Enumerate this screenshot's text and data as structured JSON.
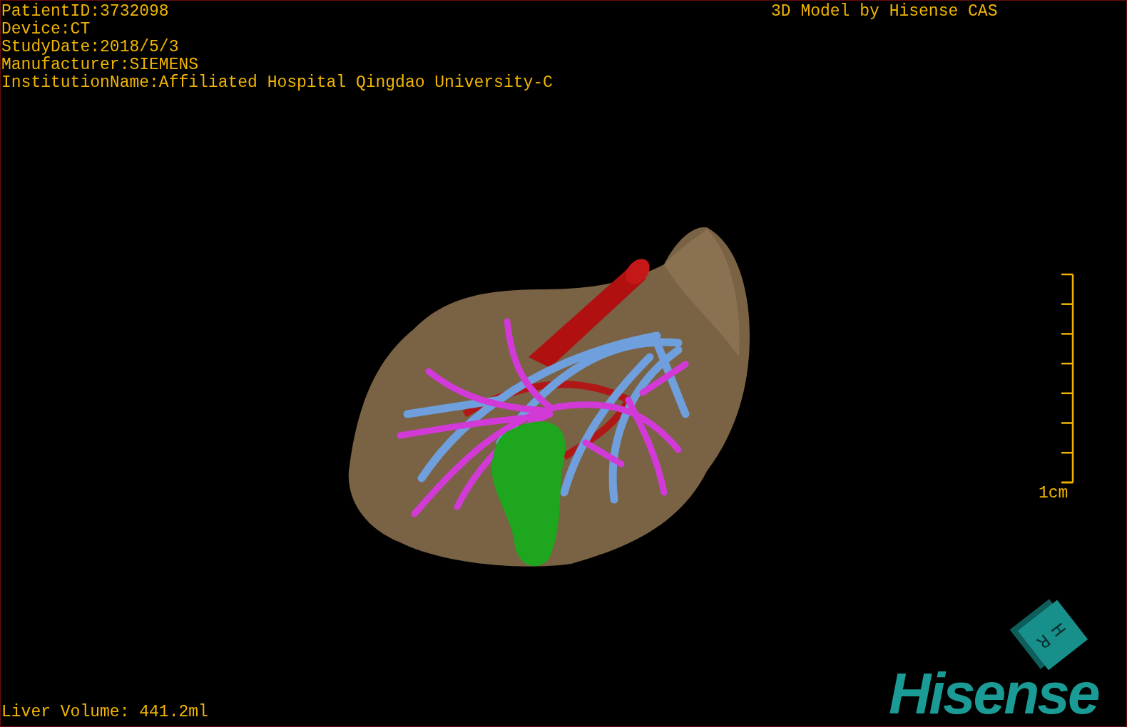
{
  "patient_info": [
    "PatientID:3732098",
    "Device:CT",
    "StudyDate:2018/5/3",
    "Manufacturer:SIEMENS",
    "InstitutionName:Affiliated Hospital Qingdao University-C"
  ],
  "title": "3D Model by Hisense CAS",
  "scale_bar": {
    "label": "1cm"
  },
  "orientation_cube": {
    "labels": [
      "H",
      "R"
    ]
  },
  "logo": "Hisense",
  "liver_volume": "Liver Volume: 441.2ml"
}
